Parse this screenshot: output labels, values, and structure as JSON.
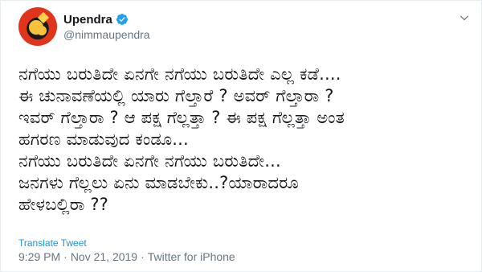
{
  "user": {
    "display_name": "Upendra",
    "handle": "@nimmaupendra",
    "verified": true,
    "avatar_icon": "user-avatar"
  },
  "tweet": {
    "lines": [
      "ನಗೆಯು ಬರುತಿದೇ ಏನಗೇ ನಗೆಯು ಬರುತಿದೇ  ಎಲ್ಲ ಕಡೆ....",
      "ಈ ಚುನಾವಣೆಯಲ್ಲಿ ಯಾರು ಗೆಲ್ತಾರೆ ? ಅವರ್ ಗೆಲ್ತಾರಾ ?",
      "ಇವರ್ ಗೆಲ್ತಾರಾ ? ಆ ಪಕ್ಷ ಗೆಲ್ಲತ್ತಾ ? ಈ ಪಕ್ಷ ಗೆಲ್ಲತ್ತಾ ಅಂತ",
      "ಹಗರಣ ಮಾಡುವುದ ಕಂಡೂ...",
      "ನಗೆಯು ಬರುತಿದೇ ಏನಗೇ ನಗೆಯು ಬರುತಿದೇ...",
      "ಜನಗಳು ಗೆಲ್ಲಲು ಏನು ಮಾಡಬೇಕು..?ಯಾರಾದರೂ",
      "ಹೇಳಬಲ್ಲಿರಾ ??"
    ],
    "translate_label": "Translate Tweet"
  },
  "meta": {
    "time": "9:29 PM",
    "separator": "·",
    "date": "Nov 21, 2019",
    "source": "Twitter for iPhone"
  },
  "colors": {
    "text": "#14171a",
    "secondary": "#657786",
    "link": "#1b95e0",
    "verified": "#1da1f2"
  }
}
